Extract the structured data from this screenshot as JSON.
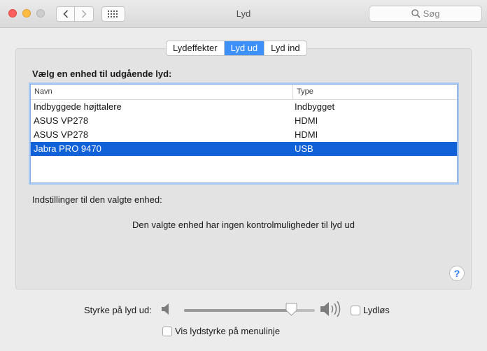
{
  "window": {
    "title": "Lyd"
  },
  "toolbar": {
    "search_placeholder": "Søg"
  },
  "tabs": [
    {
      "label": "Lydeffekter",
      "active": false
    },
    {
      "label": "Lyd ud",
      "active": true
    },
    {
      "label": "Lyd ind",
      "active": false
    }
  ],
  "output": {
    "choose_label": "Vælg en enhed til udgående lyd:",
    "columns": {
      "name": "Navn",
      "type": "Type"
    },
    "devices": [
      {
        "name": "Indbyggede højttalere",
        "type": "Indbygget",
        "selected": false
      },
      {
        "name": "ASUS VP278",
        "type": "HDMI",
        "selected": false
      },
      {
        "name": "ASUS VP278",
        "type": "HDMI",
        "selected": false
      },
      {
        "name": "Jabra PRO 9470",
        "type": "USB",
        "selected": true
      }
    ],
    "settings_label": "Indstillinger til den valgte enhed:",
    "no_controls_text": "Den valgte enhed har ingen kontrolmuligheder til lyd ud"
  },
  "help": {
    "symbol": "?"
  },
  "volume": {
    "label": "Styrke på lyd ud:",
    "level": 0.82,
    "mute_label": "Lydløs",
    "mute_checked": false,
    "show_in_menubar_label": "Vis lydstyrke på menulinje",
    "show_in_menubar_checked": false
  },
  "colors": {
    "accent": "#3e90f9",
    "selection": "#1162d8",
    "close": "#fc605c",
    "minimize": "#fdbc40"
  }
}
